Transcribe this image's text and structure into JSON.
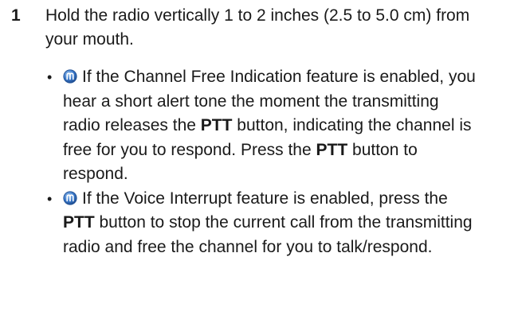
{
  "step": {
    "number": "1",
    "text": "Hold the radio vertically 1 to 2 inches (2.5 to 5.0 cm) from your mouth."
  },
  "bullets": [
    {
      "icon": "feature-indicator-icon",
      "before": "If the Channel Free Indication feature is enabled, you hear a short alert tone the moment the transmitting radio releases the ",
      "bold1": "PTT",
      "middle": " button, indicating the channel is free for you to respond. Press the ",
      "bold2": "PTT",
      "after": " button to respond."
    },
    {
      "icon": "feature-indicator-icon",
      "before": "If the Voice Interrupt feature is enabled, press the ",
      "bold1": "PTT",
      "after": " button to stop the current call from the transmitting radio and free the channel for you to talk/respond."
    }
  ],
  "bullet_glyph": "•",
  "colors": {
    "text": "#1a1a1a",
    "icon_blue": "#3a78c9"
  }
}
